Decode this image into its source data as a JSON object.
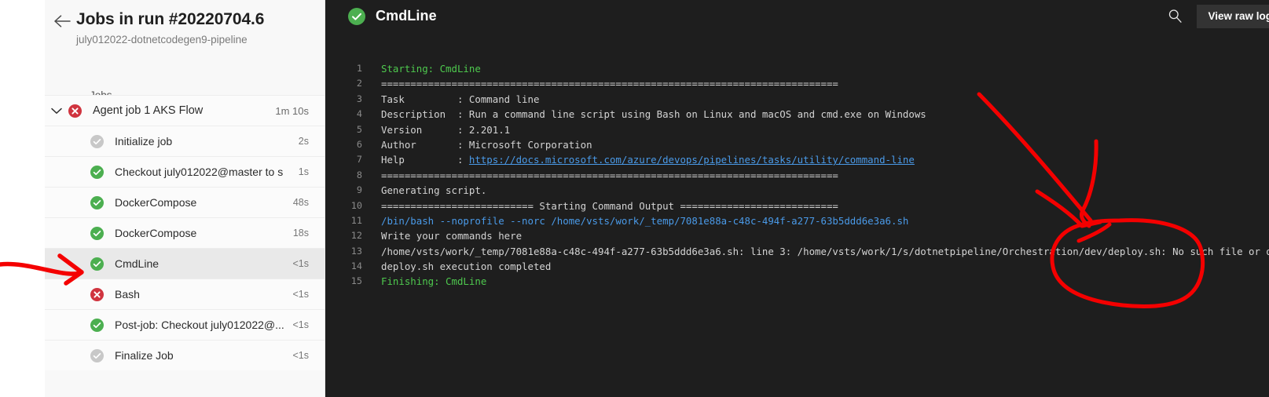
{
  "sidebar": {
    "back_icon": "back-arrow-icon",
    "title": "Jobs in run #20220704.6",
    "subtitle": "july012022-dotnetcodegen9-pipeline",
    "section_label": "Jobs",
    "jobs": [
      {
        "name": "Agent job 1 AKS Flow",
        "duration": "1m 10s",
        "status": "failed",
        "group": true,
        "selected": false,
        "expanded": true
      },
      {
        "name": "Initialize job",
        "duration": "2s",
        "status": "skipped",
        "group": false,
        "selected": false
      },
      {
        "name": "Checkout july012022@master to s",
        "duration": "1s",
        "status": "success",
        "group": false,
        "selected": false
      },
      {
        "name": "DockerCompose",
        "duration": "48s",
        "status": "success",
        "group": false,
        "selected": false
      },
      {
        "name": "DockerCompose",
        "duration": "18s",
        "status": "success",
        "group": false,
        "selected": false
      },
      {
        "name": "CmdLine",
        "duration": "<1s",
        "status": "success",
        "group": false,
        "selected": true
      },
      {
        "name": "Bash",
        "duration": "<1s",
        "status": "failed",
        "group": false,
        "selected": false
      },
      {
        "name": "Post-job: Checkout july012022@...",
        "duration": "<1s",
        "status": "success",
        "group": false,
        "selected": false
      },
      {
        "name": "Finalize Job",
        "duration": "<1s",
        "status": "skipped",
        "group": false,
        "selected": false
      }
    ]
  },
  "log": {
    "header_title": "CmdLine",
    "header_status": "success",
    "search_icon": "search-icon",
    "view_raw_label": "View raw log",
    "lines": [
      {
        "n": "1",
        "text": "Starting: CmdLine",
        "color": "green"
      },
      {
        "n": "2",
        "text": "==============================================================================",
        "color": "plain"
      },
      {
        "n": "3",
        "text": "Task         : Command line",
        "color": "plain"
      },
      {
        "n": "4",
        "text": "Description  : Run a command line script using Bash on Linux and macOS and cmd.exe on Windows",
        "color": "plain"
      },
      {
        "n": "5",
        "text": "Version      : 2.201.1",
        "color": "plain"
      },
      {
        "n": "6",
        "text": "Author       : Microsoft Corporation",
        "color": "plain"
      },
      {
        "n": "7",
        "text": "Help         : ",
        "link": "https://docs.microsoft.com/azure/devops/pipelines/tasks/utility/command-line",
        "color": "plain"
      },
      {
        "n": "8",
        "text": "==============================================================================",
        "color": "plain"
      },
      {
        "n": "9",
        "text": "Generating script.",
        "color": "plain"
      },
      {
        "n": "10",
        "text": "========================== Starting Command Output ===========================",
        "color": "plain"
      },
      {
        "n": "11",
        "text": "/bin/bash --noprofile --norc /home/vsts/work/_temp/7081e88a-c48c-494f-a277-63b5ddd6e3a6.sh",
        "color": "blue"
      },
      {
        "n": "12",
        "text": "Write your commands here",
        "color": "plain"
      },
      {
        "n": "13",
        "text": "/home/vsts/work/_temp/7081e88a-c48c-494f-a277-63b5ddd6e3a6.sh: line 3: /home/vsts/work/1/s/dotnetpipeline/Orchestration/dev/deploy.sh: No such file or directory",
        "color": "plain"
      },
      {
        "n": "14",
        "text": "deploy.sh execution completed",
        "color": "plain"
      },
      {
        "n": "15",
        "text": "Finishing: CmdLine",
        "color": "green"
      }
    ]
  },
  "annotations": {
    "color": "#f40000",
    "arrow_left_label": "arrow pointing at CmdLine step",
    "arrow_right_label": "arrow pointing at error text",
    "ellipse_label": "circle around No such file or directory"
  },
  "colors": {
    "accent_green": "#4caf50",
    "accent_red": "#d0343f",
    "log_background": "#1e1e1e",
    "sidebar_background": "#f8f8f8",
    "annotation_red": "#f40000",
    "link_blue": "#4a9ae8"
  }
}
